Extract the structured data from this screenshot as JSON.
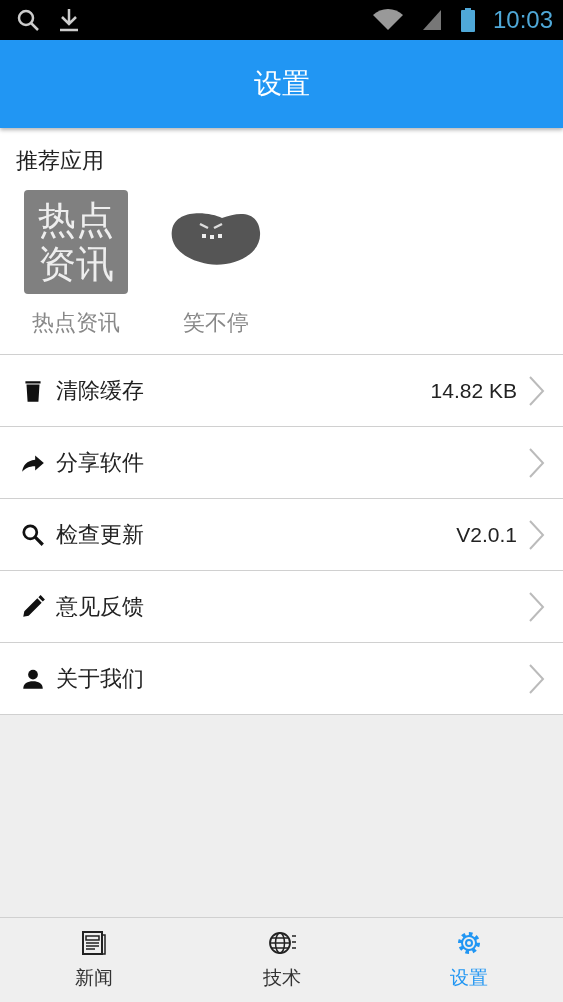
{
  "status_bar": {
    "time": "10:03"
  },
  "header": {
    "title": "设置"
  },
  "recommended": {
    "title": "推荐应用",
    "apps": [
      {
        "kind": "text_tile",
        "tile_text": [
          "热点",
          "资讯"
        ],
        "name": "热点资讯"
      },
      {
        "kind": "bean",
        "name": "笑不停"
      }
    ]
  },
  "settings": [
    {
      "kind": "trash",
      "label": "清除缓存",
      "value": "14.82 KB"
    },
    {
      "kind": "share",
      "label": "分享软件"
    },
    {
      "kind": "search",
      "label": "检查更新",
      "value": "V2.0.1"
    },
    {
      "kind": "edit",
      "label": "意见反馈"
    },
    {
      "kind": "user",
      "label": "关于我们"
    }
  ],
  "bottom_nav": [
    {
      "kind": "news",
      "label": "新闻",
      "selected": false
    },
    {
      "kind": "globe",
      "label": "技术",
      "selected": false
    },
    {
      "kind": "gear",
      "label": "设置",
      "selected": true
    }
  ]
}
